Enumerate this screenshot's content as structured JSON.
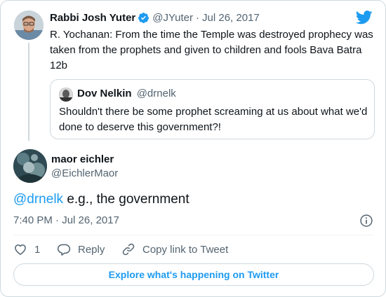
{
  "parent_tweet": {
    "author_name": "Rabbi Josh Yuter",
    "handle": "@JYuter",
    "separator": "·",
    "date": "Jul 26, 2017",
    "text": "R. Yochanan: From the time the Temple was destroyed prophecy was taken from the prophets and given to children and fools Bava Batra 12b",
    "verified": true
  },
  "quoted_tweet": {
    "author_name": "Dov Nelkin",
    "handle": "@drnelk",
    "text": "Shouldn't there be some prophet screaming at us about what we'd done to deserve this government?!"
  },
  "main_tweet": {
    "author_name": "maor eichler",
    "handle": "@EichlerMaor",
    "mention": "@drnelk",
    "text_rest": " e.g., the government",
    "time": "7:40 PM",
    "separator": "·",
    "date": "Jul 26, 2017"
  },
  "actions": {
    "like_count": "1",
    "reply_label": "Reply",
    "copy_link_label": "Copy link to Tweet"
  },
  "explore_label": "Explore what's happening on Twitter",
  "colors": {
    "accent": "#1d9bf0",
    "text_primary": "#0f1419",
    "text_secondary": "#536471",
    "border": "#cfd9de"
  },
  "icons": [
    "verified-badge-icon",
    "twitter-bird-icon",
    "info-icon",
    "heart-icon",
    "reply-bubble-icon",
    "link-icon"
  ]
}
